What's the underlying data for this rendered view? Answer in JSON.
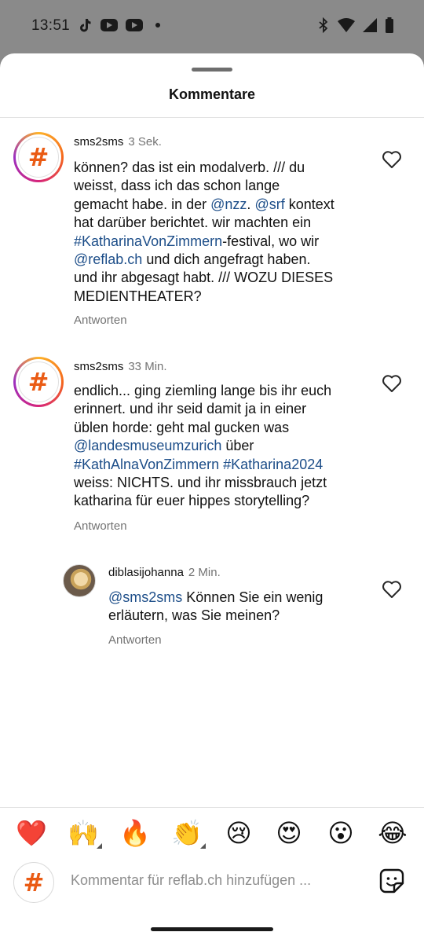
{
  "status": {
    "time": "13:51"
  },
  "sheet": {
    "title": "Kommentare"
  },
  "comments": [
    {
      "user": "sms2sms",
      "time": "3 Sek.",
      "lines": [
        [
          {
            "t": "können? das ist ein modalverb. /// du"
          }
        ],
        [
          {
            "t": "weisst, dass ich das schon lange"
          }
        ],
        [
          {
            "t": "gemacht habe. in der "
          },
          {
            "t": "@nzz",
            "m": true
          },
          {
            "t": ". "
          },
          {
            "t": "@srf",
            "m": true
          },
          {
            "t": " kontext"
          }
        ],
        [
          {
            "t": "hat darüber berichtet. wir machten ein"
          }
        ],
        [
          {
            "t": "#KatharinaVonZimmern",
            "m": true
          },
          {
            "t": "-festival, wo wir"
          }
        ],
        [
          {
            "t": "@reflab.ch",
            "m": true
          },
          {
            "t": " und dich angefragt haben."
          }
        ],
        [
          {
            "t": "und ihr abgesagt habt. /// WOZU DIESES"
          }
        ],
        [
          {
            "t": "MEDIENTHEATER?"
          }
        ]
      ],
      "reply_label": "Antworten"
    },
    {
      "user": "sms2sms",
      "time": "33 Min.",
      "lines": [
        [
          {
            "t": "endlich... ging ziemling lange bis ihr euch"
          }
        ],
        [
          {
            "t": "erinnert. und ihr seid damit ja in einer"
          }
        ],
        [
          {
            "t": "üblen horde: geht mal gucken was"
          }
        ],
        [
          {
            "t": "@landesmuseumzurich",
            "m": true
          },
          {
            "t": " über"
          }
        ],
        [
          {
            "t": "#KathAlnaVonZimmern",
            "m": true
          },
          {
            "t": " "
          },
          {
            "t": "#Katharina2024",
            "m": true
          }
        ],
        [
          {
            "t": "weiss: NICHTS. und ihr missbrauch jetzt"
          }
        ],
        [
          {
            "t": "katharina für euer hippes storytelling?"
          }
        ]
      ],
      "reply_label": "Antworten"
    },
    {
      "user": "diblasijohanna",
      "time": "2 Min.",
      "lines": [
        [
          {
            "t": "@sms2sms",
            "m": true
          },
          {
            "t": " Können Sie ein wenig"
          }
        ],
        [
          {
            "t": "erläutern, was Sie meinen?"
          }
        ]
      ],
      "reply_label": "Antworten"
    }
  ],
  "reactions": [
    "❤️",
    "🙌",
    "🔥",
    "👏",
    "😢",
    "😍",
    "😮",
    "😂"
  ],
  "compose": {
    "placeholder": "Kommentar für reflab.ch hinzufügen ..."
  },
  "logo_glyph": "#"
}
